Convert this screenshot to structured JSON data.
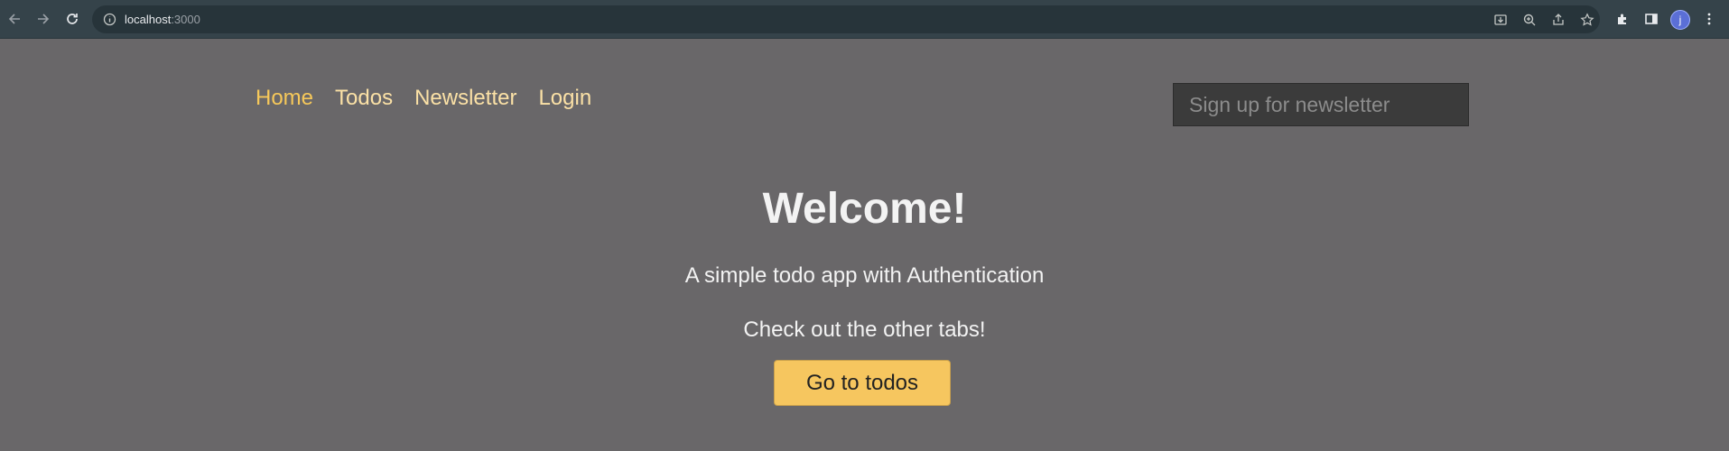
{
  "browser": {
    "url_host": "localhost",
    "url_port": ":3000",
    "avatar_letter": "j"
  },
  "nav": {
    "items": [
      {
        "label": "Home",
        "active": true
      },
      {
        "label": "Todos"
      },
      {
        "label": "Newsletter"
      },
      {
        "label": "Login"
      }
    ]
  },
  "newsletter": {
    "placeholder": "Sign up for newsletter"
  },
  "hero": {
    "title": "Welcome!",
    "subtitle": "A simple todo app with Authentication",
    "cta_text": "Check out the other tabs!",
    "cta_button": "Go to todos"
  },
  "colors": {
    "page_bg": "#696769",
    "accent": "#f6c85a",
    "nav_link": "#fbe1a6",
    "browser_bar": "#35434a"
  }
}
